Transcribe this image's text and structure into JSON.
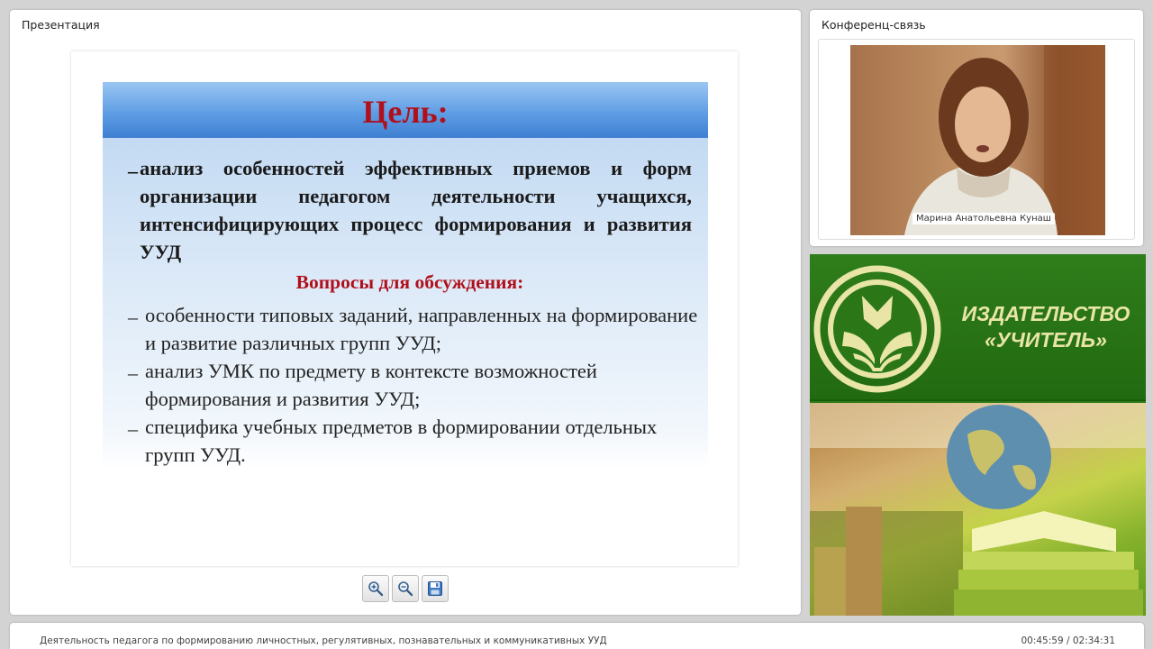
{
  "presentation": {
    "panel_title": "Презентация",
    "slide": {
      "title": "Цель:",
      "goal_text": "анализ особенностей эффективных приемов и форм организации педагогом деятельности учащихся, интенсифицирующих процесс формирования и развития УУД",
      "subtitle": "Вопросы для обсуждения:",
      "bullet_marker": "–",
      "questions": [
        "особенности типовых заданий, направленных на формирование и развитие различных групп УУД;",
        "анализ УМК по предмету в контексте возможностей формирования и развития УУД;",
        "специфика учебных предметов в формировании отдельных групп УУД."
      ]
    },
    "toolbar": {
      "zoom_in_icon": "zoom-in-icon",
      "zoom_out_icon": "zoom-out-icon",
      "save_icon": "save-icon"
    }
  },
  "conference": {
    "panel_title": "Конференц-связь",
    "speaker_name": "Марина Анатольевна Кунаш"
  },
  "publisher": {
    "name": "ИЗДАТЕЛЬСТВО\n«УЧИТЕЛЬ»",
    "brand_color": "#2c7a18",
    "text_color": "#e8e5a7"
  },
  "status_bar": {
    "course_title": "Деятельность педагога по формированию личностных, регулятивных, познавательных и коммуникативных УУД",
    "time": "00:45:59 / 02:34:31"
  }
}
